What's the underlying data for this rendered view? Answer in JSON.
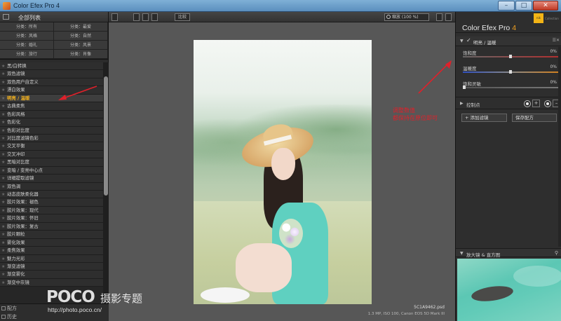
{
  "window": {
    "title": "Color Efex Pro 4",
    "buttons": [
      "–",
      "□",
      "✕"
    ]
  },
  "left_panel": {
    "header": "全部列表",
    "categories": [
      "分类：所有",
      "分类：最爱",
      "分类：风格",
      "分类：自然",
      "分类：婚礼",
      "分类：风景",
      "分类：旅行",
      "分类：肖像"
    ],
    "filters": [
      "黑/白转换",
      "双色滤镜",
      "双色用户自定义",
      "漂白效果",
      "明亮 / 温暖",
      "古典柔焦",
      "色彩风格",
      "色彩化",
      "色彩对比度",
      "对比度滤镜色彩",
      "交叉平衡",
      "交叉冲印",
      "黑暗对比度",
      "变暗 / 变亮中心点",
      "详细提取滤镜",
      "双色调",
      "动态皮肤柔化器",
      "胶片效果：褪色",
      "胶片效果：现代",
      "胶片效果：怀旧",
      "胶片效果：复古",
      "胶片颗粒",
      "雾化效果",
      "柔焦效果",
      "魅力光彩",
      "渐变滤镜",
      "渐变雾化",
      "渐变中灰镜"
    ],
    "active_index": 4,
    "bottom_items": [
      "配方",
      "历史"
    ]
  },
  "toolbar": {
    "compare_label": "比较",
    "zoom_label": "缩放 (100 %)"
  },
  "photo": {
    "filename": "5C1A9462.psd",
    "meta": "1.3 MP, ISO 100, Canon EOS 5D Mark III"
  },
  "annotation": {
    "line1": "调整数值",
    "line2": "都保持在原位即可"
  },
  "watermark": {
    "logo": "POCO",
    "title": "摄影专题",
    "url": "http://photo.poco.cn/"
  },
  "right_panel": {
    "brand": "Color Efex Pro",
    "version": "4",
    "nik_logo": "nik",
    "nik_sub": "Collection",
    "filter_title": "明亮 / 温暖",
    "sliders": [
      {
        "label": "饱和度",
        "value": "0%",
        "level": 0.5
      },
      {
        "label": "温暖度",
        "value": "0%",
        "level": 0.5
      },
      {
        "label": "饱和灵敏",
        "value": "0%",
        "level": 0.0
      }
    ],
    "control_points_label": "控制点",
    "add_filter": "+ 添加滤镜",
    "save_recipe": "保存配方",
    "loupe_label": "放大镜 & 直方图"
  },
  "colors": {
    "accent_orange": "#f0a020",
    "active_filter": "#f0b020",
    "annotation_red": "#e0202a"
  }
}
